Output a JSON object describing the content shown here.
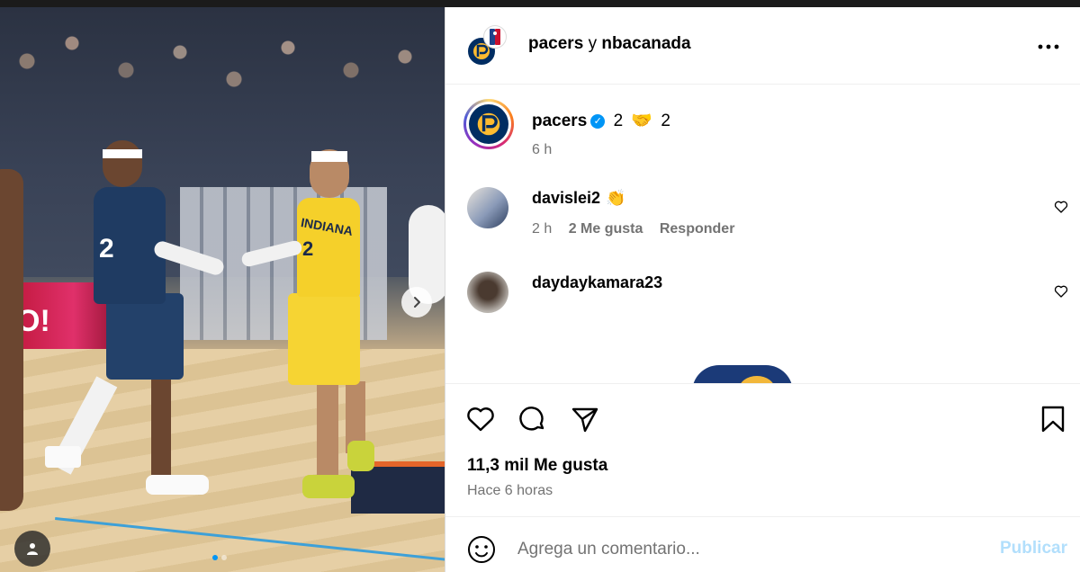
{
  "header": {
    "user": "pacers",
    "connector": "y",
    "collab_user": "nbacanada"
  },
  "caption": {
    "user": "pacers",
    "verified_mark": "✓",
    "text_count1": "2",
    "emoji": "🤝",
    "text_count2": "2",
    "time": "6 h"
  },
  "comments": [
    {
      "user": "davislei2",
      "text": "👏",
      "time": "2 h",
      "likes": "2 Me gusta",
      "reply": "Responder"
    },
    {
      "user": "daydaykamara23",
      "text": "",
      "time": "",
      "likes": "",
      "reply": ""
    }
  ],
  "photo": {
    "banner_text": "O!",
    "jersey_left_number": "2",
    "jersey_right_number": "2",
    "jersey_right_name": "INDIANA"
  },
  "stats": {
    "likes": "11,3 mil Me gusta",
    "posted": "Hace 6 horas"
  },
  "composer": {
    "placeholder": "Agrega un comentario...",
    "publish": "Publicar"
  },
  "colors": {
    "pacers_navy": "#002d62",
    "pacers_gold": "#fdbb30",
    "publish_disabled": "#b2dffc",
    "verified_blue": "#0095f6"
  },
  "icons": {
    "header_more": "more-horizontal-icon",
    "like": "heart-icon",
    "comment": "comment-icon",
    "share": "share-icon",
    "save": "bookmark-icon",
    "emoji": "emoji-icon",
    "next": "chevron-right-icon",
    "tags": "user-tag-icon"
  }
}
